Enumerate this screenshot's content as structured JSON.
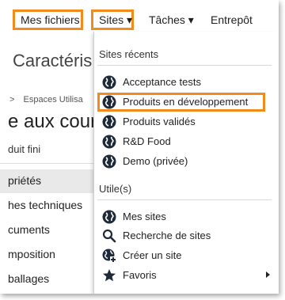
{
  "topnav": {
    "files": "Mes fichiers",
    "sites": "Sites ▾",
    "tasks": "Tâches ▾",
    "store": "Entrepôt"
  },
  "background": {
    "title": "Caractéris",
    "breadcrumb_sep": ">",
    "breadcrumb": "Espaces Utilisa",
    "heading": "e aux cour",
    "sub": "duit fini",
    "items": [
      "priétés",
      "hes techniques",
      "cuments",
      "mposition",
      "ballages"
    ]
  },
  "menu": {
    "recent_header": "Sites récents",
    "recent": [
      {
        "label": "Acceptance tests",
        "icon": "globe-icon"
      },
      {
        "label": "Produits en développement",
        "icon": "globe-icon"
      },
      {
        "label": "Produits validés",
        "icon": "globe-icon"
      },
      {
        "label": "R&D Food",
        "icon": "globe-icon"
      },
      {
        "label": "Demo (privée)",
        "icon": "globe-icon"
      }
    ],
    "useful_header": "Utile(s)",
    "useful": [
      {
        "label": "Mes sites",
        "icon": "globe-icon"
      },
      {
        "label": "Recherche de sites",
        "icon": "search-icon"
      },
      {
        "label": "Créer un site",
        "icon": "globe-add-icon"
      },
      {
        "label": "Favoris",
        "icon": "star-icon"
      }
    ]
  },
  "colors": {
    "highlight": "#f28a1c",
    "icon": "#1e2a3a"
  }
}
